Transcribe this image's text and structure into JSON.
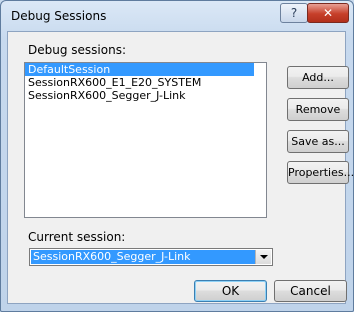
{
  "window": {
    "title": "Debug Sessions",
    "help": "?",
    "close": "✕"
  },
  "sessions_label": "Debug sessions:",
  "sessions": [
    "DefaultSession",
    "SessionRX600_E1_E20_SYSTEM",
    "SessionRX600_Segger_J-Link"
  ],
  "selected_index": 0,
  "buttons": {
    "add": "Add...",
    "remove": "Remove",
    "save_as": "Save as...",
    "properties": "Properties..."
  },
  "current_label": "Current session:",
  "current_value": "SessionRX600_Segger_J-Link",
  "ok": "OK",
  "cancel": "Cancel"
}
